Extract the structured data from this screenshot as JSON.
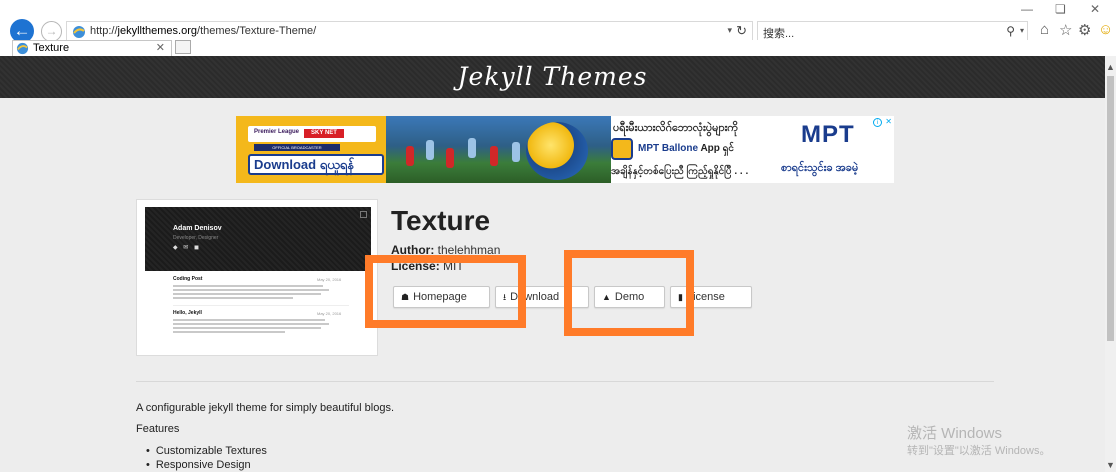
{
  "browser": {
    "address_domain": "jekyllthemes.org",
    "address_prefix": "http://",
    "address_path": "/themes/Texture-Theme/",
    "search_placeholder": "搜索...",
    "tab_title": "Texture"
  },
  "site": {
    "title": "Jekyll Themes"
  },
  "ad": {
    "download_label": "Download ရယူရန်",
    "headline_my": "ပရီးမီးယားလိဂ်ဘောလုံးပွဲများကို",
    "app_label": "MPT Ballone",
    "app_suffix": "App ရှင်",
    "sub_my": "အချိန်နှင့်တစ်ပြေးညီ ကြည့်ရှုနိုင်ပြီ . . .",
    "brand_logo": "MPT",
    "cta_my": "စာရင်းသွင်းခ အခမဲ့",
    "badge_league": "Premier League",
    "badge_sky": "SKY NET",
    "badge_broadcaster": "OFFICIAL BROADCASTER"
  },
  "preview": {
    "author_name": "Adam Denisov",
    "author_role": "Developer, Designer",
    "social_icons": "◆ ✉ ◼",
    "posts": [
      {
        "title": "Coding Post",
        "date": "May 20, 2016"
      },
      {
        "title": "Hello, Jekyll",
        "date": "May 20, 2016"
      }
    ]
  },
  "theme": {
    "name": "Texture",
    "author_label": "Author:",
    "author_value": "thelehhman",
    "license_label": "License:",
    "license_value": "MIT",
    "buttons": {
      "homepage": "Homepage",
      "download": "Download",
      "demo": "Demo",
      "license": "License"
    },
    "description": "A configurable jekyll theme for simply beautiful blogs.",
    "features_heading": "Features",
    "features": [
      "Customizable Textures",
      "Responsive Design"
    ]
  },
  "watermark": {
    "line1": "激活 Windows",
    "line2": "转到\"设置\"以激活 Windows。"
  },
  "colors": {
    "highlight": "#ff7b29",
    "header_bg": "#2b2b2b",
    "page_bg": "#ededed",
    "ad_yellow": "#f4b81b",
    "ad_blue": "#1a3c8d"
  }
}
